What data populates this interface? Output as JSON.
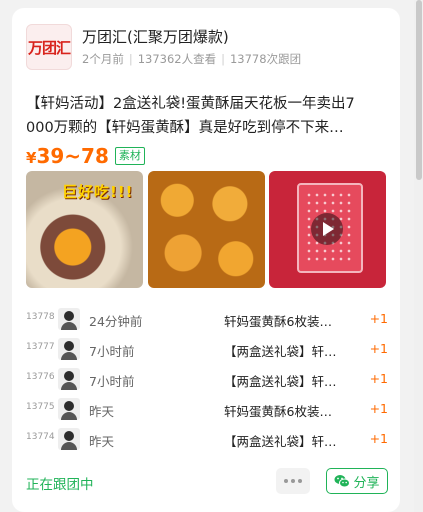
{
  "group": {
    "logo_text": "万团汇",
    "name": "万团汇(汇聚万团爆款)",
    "posted": "2个月前",
    "views": "137362人查看",
    "followers": "13778次跟团"
  },
  "post": {
    "desc_line1": "【轩妈活动】2盒送礼袋!蛋黄酥届天花板一年卖出7",
    "desc_line2": "000万颗的【轩妈蛋黄酥】真是好吃到停不下来…",
    "price_symbol": "¥",
    "price_range": "39~78",
    "tag": "素材",
    "image1_overlay": "巨好吃!!!"
  },
  "orders": [
    {
      "num": "13778",
      "time": "24分钟前",
      "product": "轩妈蛋黄酥6枚装…",
      "qty": "+1"
    },
    {
      "num": "13777",
      "time": "7小时前",
      "product": "【两盒送礼袋】轩…",
      "qty": "+1"
    },
    {
      "num": "13776",
      "time": "7小时前",
      "product": "【两盒送礼袋】轩…",
      "qty": "+1"
    },
    {
      "num": "13775",
      "time": "昨天",
      "product": "轩妈蛋黄酥6枚装…",
      "qty": "+1"
    },
    {
      "num": "13774",
      "time": "昨天",
      "product": "【两盒送礼袋】轩…",
      "qty": "+1"
    }
  ],
  "footer": {
    "status": "正在跟团中",
    "share_label": "分享"
  },
  "colors": {
    "accent_green": "#20b358",
    "price_orange": "#ff6a00",
    "brand_red": "#d8231c"
  }
}
